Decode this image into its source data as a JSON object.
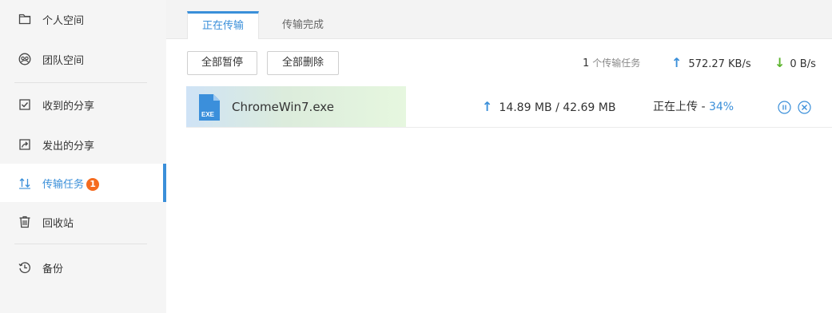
{
  "sidebar": {
    "items": [
      {
        "label": "个人空间",
        "icon": "folder-icon"
      },
      {
        "label": "团队空间",
        "icon": "team-icon"
      },
      {
        "label": "收到的分享",
        "icon": "received-share-icon"
      },
      {
        "label": "发出的分享",
        "icon": "sent-share-icon"
      },
      {
        "label": "传输任务",
        "icon": "transfer-icon",
        "badge": "1",
        "active": true
      },
      {
        "label": "回收站",
        "icon": "trash-icon"
      },
      {
        "label": "备份",
        "icon": "backup-icon"
      }
    ]
  },
  "tabs": {
    "active": "正在传输",
    "inactive": "传输完成"
  },
  "toolbar": {
    "pause_all": "全部暂停",
    "delete_all": "全部删除"
  },
  "stats": {
    "task_count": "1",
    "task_unit": "个传输任务",
    "upload_speed": "572.27 KB/s",
    "download_speed": "0 B/s"
  },
  "transfer": {
    "file_name": "ChromeWin7.exe",
    "file_type": "EXE",
    "size_progress": "14.89 MB / 42.69 MB",
    "status": "正在上传 - ",
    "percent": "34%",
    "progress_fraction": 0.34
  },
  "colors": {
    "accent": "#3a8fd9",
    "badge": "#f56b1f",
    "download": "#5bb32c"
  }
}
